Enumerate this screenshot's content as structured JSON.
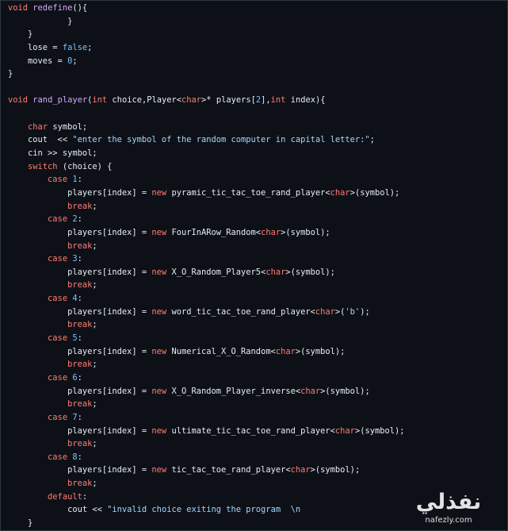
{
  "code_view": {
    "lines": [
      [
        [
          "kw",
          "void"
        ],
        [
          "txt",
          " "
        ],
        [
          "fn",
          "redefine"
        ],
        [
          "txt",
          "(){"
        ]
      ],
      [
        [
          "txt",
          "            }"
        ]
      ],
      [
        [
          "txt",
          "    }"
        ]
      ],
      [
        [
          "txt",
          "    lose = "
        ],
        [
          "const",
          "false"
        ],
        [
          "txt",
          ";"
        ]
      ],
      [
        [
          "txt",
          "    moves = "
        ],
        [
          "num",
          "0"
        ],
        [
          "txt",
          ";"
        ]
      ],
      [
        [
          "txt",
          "}"
        ]
      ],
      [
        [
          "txt",
          ""
        ]
      ],
      [
        [
          "kw",
          "void"
        ],
        [
          "txt",
          " "
        ],
        [
          "fn",
          "rand_player"
        ],
        [
          "txt",
          "("
        ],
        [
          "type",
          "int"
        ],
        [
          "txt",
          " choice,Player<"
        ],
        [
          "type",
          "char"
        ],
        [
          "txt",
          ">* players["
        ],
        [
          "num",
          "2"
        ],
        [
          "txt",
          "],"
        ],
        [
          "type",
          "int"
        ],
        [
          "txt",
          " index){"
        ]
      ],
      [
        [
          "txt",
          ""
        ]
      ],
      [
        [
          "txt",
          "    "
        ],
        [
          "type",
          "char"
        ],
        [
          "txt",
          " symbol;"
        ]
      ],
      [
        [
          "txt",
          "    cout  << "
        ],
        [
          "str",
          "\"enter the symbol of the random computer in capital letter:\""
        ],
        [
          "txt",
          ";"
        ]
      ],
      [
        [
          "txt",
          "    cin >> symbol;"
        ]
      ],
      [
        [
          "txt",
          "    "
        ],
        [
          "kw",
          "switch"
        ],
        [
          "txt",
          " (choice) {"
        ]
      ],
      [
        [
          "txt",
          "        "
        ],
        [
          "kw",
          "case"
        ],
        [
          "txt",
          " "
        ],
        [
          "num",
          "1"
        ],
        [
          "txt",
          ":"
        ]
      ],
      [
        [
          "txt",
          "            players[index] = "
        ],
        [
          "kw",
          "new"
        ],
        [
          "txt",
          " pyramic_tic_tac_toe_rand_player<"
        ],
        [
          "type",
          "char"
        ],
        [
          "txt",
          ">(symbol);"
        ]
      ],
      [
        [
          "txt",
          "            "
        ],
        [
          "kw",
          "break"
        ],
        [
          "txt",
          ";"
        ]
      ],
      [
        [
          "txt",
          "        "
        ],
        [
          "kw",
          "case"
        ],
        [
          "txt",
          " "
        ],
        [
          "num",
          "2"
        ],
        [
          "txt",
          ":"
        ]
      ],
      [
        [
          "txt",
          "            players[index] = "
        ],
        [
          "kw",
          "new"
        ],
        [
          "txt",
          " FourInARow_Random<"
        ],
        [
          "type",
          "char"
        ],
        [
          "txt",
          ">(symbol);"
        ]
      ],
      [
        [
          "txt",
          "            "
        ],
        [
          "kw",
          "break"
        ],
        [
          "txt",
          ";"
        ]
      ],
      [
        [
          "txt",
          "        "
        ],
        [
          "kw",
          "case"
        ],
        [
          "txt",
          " "
        ],
        [
          "num",
          "3"
        ],
        [
          "txt",
          ":"
        ]
      ],
      [
        [
          "txt",
          "            players[index] = "
        ],
        [
          "kw",
          "new"
        ],
        [
          "txt",
          " X_O_Random_Player5<"
        ],
        [
          "type",
          "char"
        ],
        [
          "txt",
          ">(symbol);"
        ]
      ],
      [
        [
          "txt",
          "            "
        ],
        [
          "kw",
          "break"
        ],
        [
          "txt",
          ";"
        ]
      ],
      [
        [
          "txt",
          "        "
        ],
        [
          "kw",
          "case"
        ],
        [
          "txt",
          " "
        ],
        [
          "num",
          "4"
        ],
        [
          "txt",
          ":"
        ]
      ],
      [
        [
          "txt",
          "            players[index] = "
        ],
        [
          "kw",
          "new"
        ],
        [
          "txt",
          " word_tic_tac_toe_rand_player<"
        ],
        [
          "type",
          "char"
        ],
        [
          "txt",
          ">("
        ],
        [
          "str",
          "'b'"
        ],
        [
          "txt",
          ");"
        ]
      ],
      [
        [
          "txt",
          "            "
        ],
        [
          "kw",
          "break"
        ],
        [
          "txt",
          ";"
        ]
      ],
      [
        [
          "txt",
          "        "
        ],
        [
          "kw",
          "case"
        ],
        [
          "txt",
          " "
        ],
        [
          "num",
          "5"
        ],
        [
          "txt",
          ":"
        ]
      ],
      [
        [
          "txt",
          "            players[index] = "
        ],
        [
          "kw",
          "new"
        ],
        [
          "txt",
          " Numerical_X_O_Random<"
        ],
        [
          "type",
          "char"
        ],
        [
          "txt",
          ">(symbol);"
        ]
      ],
      [
        [
          "txt",
          "            "
        ],
        [
          "kw",
          "break"
        ],
        [
          "txt",
          ";"
        ]
      ],
      [
        [
          "txt",
          "        "
        ],
        [
          "kw",
          "case"
        ],
        [
          "txt",
          " "
        ],
        [
          "num",
          "6"
        ],
        [
          "txt",
          ":"
        ]
      ],
      [
        [
          "txt",
          "            players[index] = "
        ],
        [
          "kw",
          "new"
        ],
        [
          "txt",
          " X_O_Random_Player_inverse<"
        ],
        [
          "type",
          "char"
        ],
        [
          "txt",
          ">(symbol);"
        ]
      ],
      [
        [
          "txt",
          "            "
        ],
        [
          "kw",
          "break"
        ],
        [
          "txt",
          ";"
        ]
      ],
      [
        [
          "txt",
          "        "
        ],
        [
          "kw",
          "case"
        ],
        [
          "txt",
          " "
        ],
        [
          "num",
          "7"
        ],
        [
          "txt",
          ":"
        ]
      ],
      [
        [
          "txt",
          "            players[index] = "
        ],
        [
          "kw",
          "new"
        ],
        [
          "txt",
          " ultimate_tic_tac_toe_rand_player<"
        ],
        [
          "type",
          "char"
        ],
        [
          "txt",
          ">(symbol);"
        ]
      ],
      [
        [
          "txt",
          "            "
        ],
        [
          "kw",
          "break"
        ],
        [
          "txt",
          ";"
        ]
      ],
      [
        [
          "txt",
          "        "
        ],
        [
          "kw",
          "case"
        ],
        [
          "txt",
          " "
        ],
        [
          "num",
          "8"
        ],
        [
          "txt",
          ":"
        ]
      ],
      [
        [
          "txt",
          "            players[index] = "
        ],
        [
          "kw",
          "new"
        ],
        [
          "txt",
          " tic_tac_toe_rand_player<"
        ],
        [
          "type",
          "char"
        ],
        [
          "txt",
          ">(symbol);"
        ]
      ],
      [
        [
          "txt",
          "            "
        ],
        [
          "kw",
          "break"
        ],
        [
          "txt",
          ";"
        ]
      ],
      [
        [
          "txt",
          "        "
        ],
        [
          "kw",
          "default"
        ],
        [
          "txt",
          ":"
        ]
      ],
      [
        [
          "txt",
          "            cout << "
        ],
        [
          "str",
          "\"invalid choice exiting the program"
        ],
        [
          "txt",
          "  "
        ],
        [
          "str",
          "\\n"
        ]
      ],
      [
        [
          "txt",
          "    }"
        ]
      ]
    ]
  },
  "theme": {
    "background": "#0d1117",
    "text": "#e6edf3",
    "keyword": "#ff7b72",
    "function": "#d2a8ff",
    "string": "#a5d6ff",
    "number": "#79c0ff"
  },
  "watermark": {
    "logo_text": "نفذلي",
    "url": "nafezly.com"
  }
}
